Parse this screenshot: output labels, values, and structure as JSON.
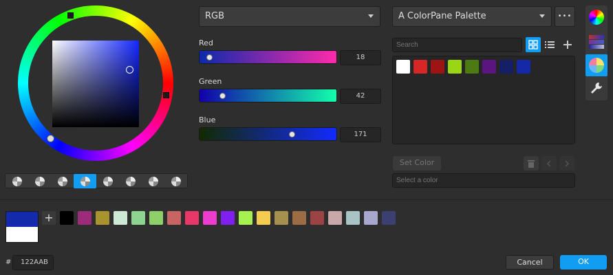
{
  "picker": {
    "mode_select": "RGB",
    "sliders": [
      {
        "label": "Red",
        "value": "18",
        "fraction": 0.07
      },
      {
        "label": "Green",
        "value": "42",
        "fraction": 0.16
      },
      {
        "label": "Blue",
        "value": "171",
        "fraction": 0.67
      }
    ]
  },
  "palette": {
    "name": "A ColorPane Palette",
    "more_label": "•••",
    "search_placeholder": "Search",
    "set_color_label": "Set Color",
    "select_placeholder": "Select a color",
    "colors": [
      "#ffffff",
      "#d62626",
      "#9c1414",
      "#9bd614",
      "#4e7a14",
      "#5c1480",
      "#141f66",
      "#1428a8"
    ]
  },
  "wheel_modes": [
    "mode-1",
    "mode-2",
    "mode-3",
    "mode-4",
    "mode-5",
    "mode-6",
    "mode-7",
    "mode-8"
  ],
  "selected_mode_index": 3,
  "quick_palette": {
    "add_label": "+",
    "colors": [
      "#000000",
      "#9c2c7a",
      "#a8942c",
      "#cde8d4",
      "#8cd490",
      "#8ecf6a",
      "#c86464",
      "#e8386a",
      "#ee3cce",
      "#8020f0",
      "#a6f050",
      "#f4cc50",
      "#a69050",
      "#9c6c44",
      "#9c4444",
      "#c8a8a8",
      "#a8c4c4",
      "#a8a8cc",
      "#3c4070"
    ]
  },
  "current_color": "#122AAB",
  "previous_color": "#ffffff",
  "hex": {
    "prefix": "#",
    "value": "122AAB"
  },
  "buttons": {
    "cancel": "Cancel",
    "ok": "OK"
  },
  "colors": {
    "accent": "#119ef2",
    "background": "#2e2e2e"
  }
}
